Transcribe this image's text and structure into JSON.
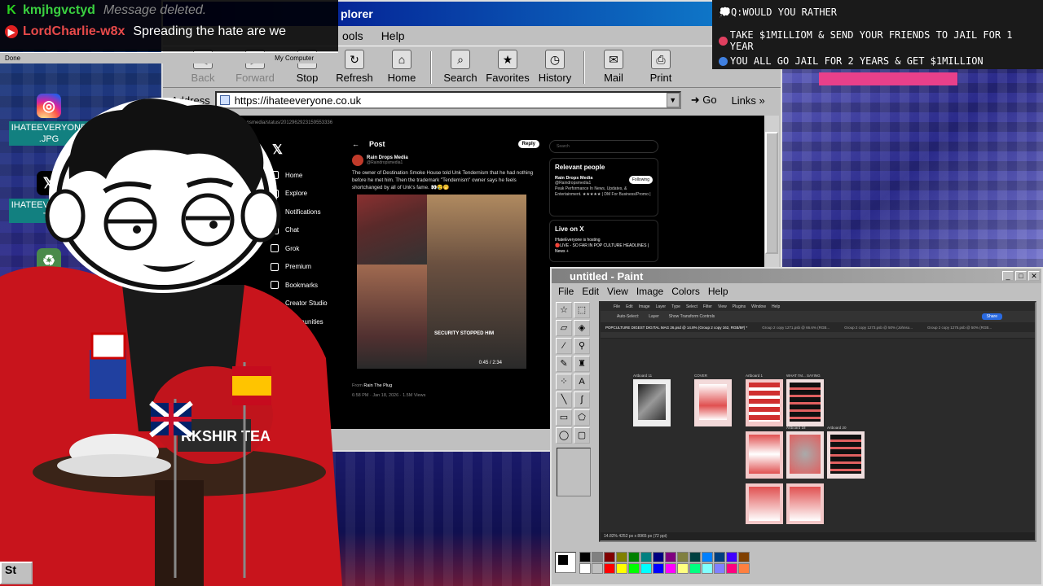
{
  "chat": {
    "messages": [
      {
        "platform_icon": "kick-icon",
        "user": "kmjhgvctyd",
        "text": "Message deleted.",
        "deleted": true
      },
      {
        "platform_icon": "youtube-icon",
        "user": "LordCharlie-w8x",
        "text": "Spreading the hate are we",
        "deleted": false
      }
    ],
    "status_left": "Done",
    "status_right": "My Computer"
  },
  "desktop_icons": [
    {
      "icon": "instagram-icon",
      "label_line1": "IHATEEVERYONE",
      "label_line2": ".JPG"
    },
    {
      "icon": "x-icon",
      "label_line1": "IHATEEVERYONE",
      "label_line2": "TX"
    },
    {
      "icon": "recycle-bin-icon",
      "label_line1": "YOUR CO",
      "label_line2": ""
    }
  ],
  "ie": {
    "title": "plorer",
    "menu": [
      "ools",
      "Help"
    ],
    "toolbar": [
      {
        "label": "Back",
        "icon": "back-arrow-icon",
        "disabled": true
      },
      {
        "label": "Forward",
        "icon": "forward-arrow-icon",
        "disabled": true
      },
      {
        "label": "Stop",
        "icon": "stop-icon",
        "disabled": false
      },
      {
        "label": "Refresh",
        "icon": "refresh-icon",
        "disabled": false
      },
      {
        "label": "Home",
        "icon": "home-icon",
        "disabled": false
      },
      {
        "label": "Search",
        "icon": "search-icon",
        "disabled": false
      },
      {
        "label": "Favorites",
        "icon": "favorites-icon",
        "disabled": false
      },
      {
        "label": "History",
        "icon": "history-icon",
        "disabled": false
      },
      {
        "label": "Mail",
        "icon": "mail-icon",
        "disabled": false
      },
      {
        "label": "Print",
        "icon": "print-icon",
        "disabled": false
      }
    ],
    "address_label": "Address",
    "address_value": "https://ihateeveryone.co.uk",
    "go_label": "Go",
    "links_label": "Links"
  },
  "x_page": {
    "url": "x.com/Raindropsmedia/status/2012962923159553336",
    "nav": [
      "Home",
      "Explore",
      "Notifications",
      "Chat",
      "Grok",
      "Premium",
      "Bookmarks",
      "Creator Studio",
      "Communities"
    ],
    "post_header": "Post",
    "reply_label": "Reply",
    "author_name": "Rain Drops Media",
    "author_handle": "@Raindropsmedia1",
    "text": "The owner of Destination Smoke House told Unk Tendernism that he had nothing before he met him. Then the trademark \"Tendernism\" owner says he feels shortchanged by all of Unk's fame. 👀😢🤭",
    "media_caption": "SECURITY STOPPED HIM",
    "video_time": "0:45 / 2:34",
    "from_label": "From",
    "from_name": "Rain The Plug",
    "meta": "6:58 PM · Jan 18, 2026 · 1.5M Views",
    "search_placeholder": "Search",
    "relevant_title": "Relevant people",
    "relevant_name": "Rain Drops Media",
    "relevant_handle": "@Raindropsmedia1",
    "follow_label": "Following",
    "relevant_desc": "Peak Performance In News, Updates, & Entertainment. ★★★★★ | DM For Business/Promo |",
    "live_title": "Live on X",
    "live_host": "IHateEveryone is hosting",
    "live_desc": "🔴LIVE - SO FAR IN POP CULTURE HEADLINES | News +"
  },
  "paint": {
    "title": "untitled - Paint",
    "menu": [
      "File",
      "Edit",
      "View",
      "Image",
      "Colors",
      "Help"
    ],
    "ps_menu": [
      "File",
      "Edit",
      "Image",
      "Layer",
      "Type",
      "Select",
      "Filter",
      "View",
      "Plugins",
      "Window",
      "Help"
    ],
    "ps_auto_select": "Auto-Select:",
    "ps_layer": "Layer",
    "ps_transform": "Show Transform Controls",
    "ps_share": "Share",
    "ps_tabs": [
      "POPCULTURE DIGEST DIGITAL MAG 26.psd @ 14.8% (Group 2 copy 162, RGB/8#) *",
      "Group 2 copy 1271.psb @ 66.6% (RGB...",
      "Group 2 copy 1273.psb @ 50% (Johnso...",
      "Group 2 copy 1275.psb @ 50% (RGB..."
    ],
    "artboards": [
      "Artboard 11",
      "COVER",
      "Artboard 1",
      "WHAT I'M... SAYING",
      "Artboard 18",
      "Artboard 20"
    ],
    "ps_status": "14.82%    4252 px x 8965 px (72 ppi)",
    "colors": [
      "#000000",
      "#808080",
      "#800000",
      "#808000",
      "#008000",
      "#008080",
      "#000080",
      "#800080",
      "#808040",
      "#004040",
      "#0080ff",
      "#004080",
      "#4000ff",
      "#804000",
      "#ffffff",
      "#c0c0c0",
      "#ff0000",
      "#ffff00",
      "#00ff00",
      "#00ffff",
      "#0000ff",
      "#ff00ff",
      "#ffff80",
      "#00ff80",
      "#80ffff",
      "#8080ff",
      "#ff0080",
      "#ff8040"
    ]
  },
  "poll": {
    "question": "Q:WOULD YOU RATHER",
    "option_a": "TAKE $1MILLIOM & SEND YOUR FRIENDS TO JAIL FOR 1 YEAR",
    "option_b": "YOU ALL GO JAIL FOR 2 YEARS & GET $1MILLION"
  },
  "mug_label": "RKSHIR TEA",
  "taskbar": {
    "start_label": "St"
  }
}
